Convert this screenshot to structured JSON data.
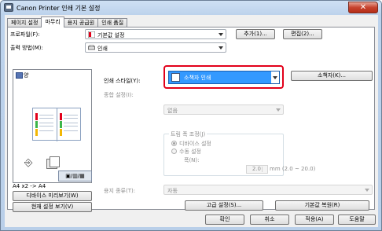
{
  "window": {
    "title": "Canon Printer 인쇄 기본 설정",
    "close_glyph": "✕"
  },
  "tabs": [
    "페이지 설정",
    "마무리",
    "용지 공급원",
    "인쇄 품질"
  ],
  "active_tab": 1,
  "header": {
    "profile_label": "프로파일(F):",
    "profile_value": "기본값 설정",
    "add_button": "추가(1)...",
    "edit_button": "편집(2)...",
    "output_label": "출력 방법(M):",
    "output_value": "인쇄"
  },
  "preview": {
    "title": "양",
    "binding_label": "",
    "caption": "A4 x2 -> A4",
    "mirror_button": "디바이스 미리보기(W)",
    "current_settings_button": "현재 설정 보기(V)"
  },
  "finishing": {
    "print_style_label": "인쇄 스타일(Y):",
    "print_style_value": "소책자 인쇄",
    "booklet_button": "소책자(K)...",
    "binding_setting_label": "종합 설정(I):",
    "binding_setting_value": "",
    "binding_direction_value": "없음",
    "trim_group_title": "트림 폭 조정(J)",
    "device_setting_radio": "디바이스 설정",
    "manual_setting_radio": "수동 설정",
    "width_label": "폭(N):",
    "width_value": "2.0",
    "width_unit": "mm (2.0 ~ 20.0)",
    "paper_type_label": "용지 종류(T):",
    "paper_type_value": "자동"
  },
  "footer": {
    "advanced_button": "고급 설정(S)...",
    "restore_button": "기본값 복원(R)",
    "ok_button": "확인",
    "cancel_button": "취소",
    "apply_button": "적용(A)",
    "help_button": "도움말"
  },
  "colors": {
    "accent": "#3399ff",
    "highlight_border": "#e2001a"
  }
}
